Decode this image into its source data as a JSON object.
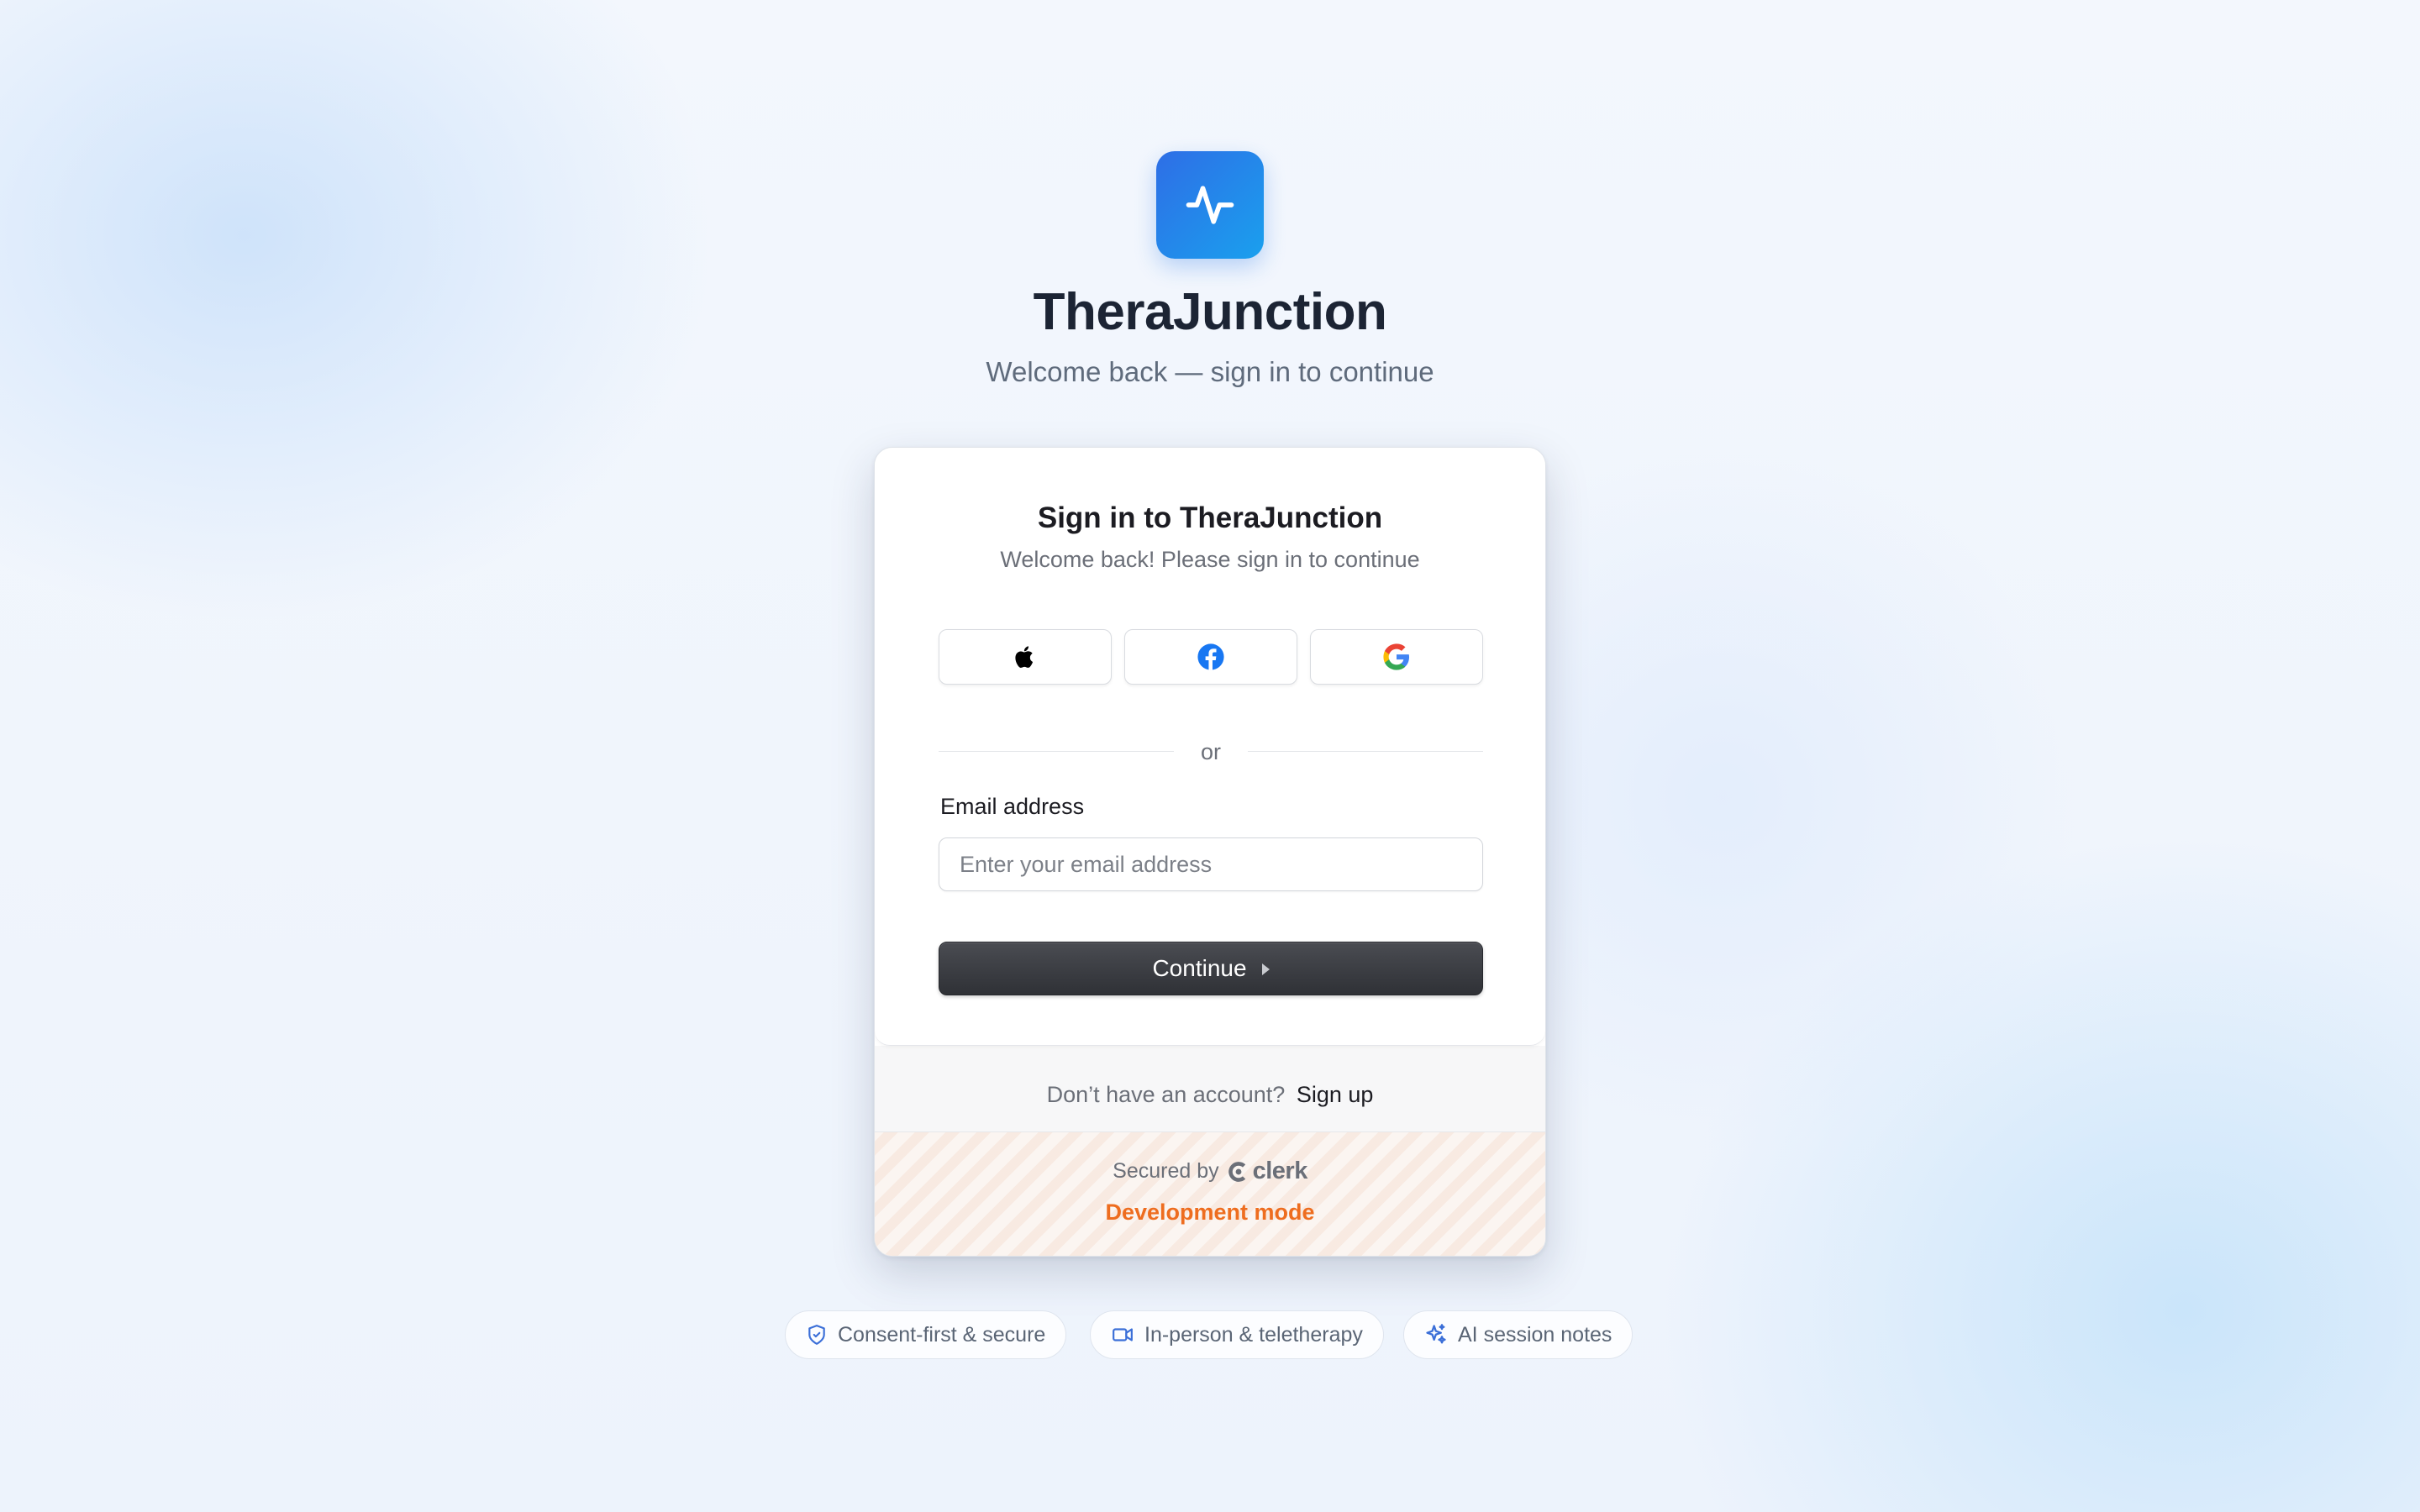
{
  "brand": {
    "name": "TheraJunction",
    "tagline": "Welcome back — sign in to continue",
    "logo_icon": "activity-pulse-icon",
    "accent_gradient": [
      "#2e6ee6",
      "#1aa0ee"
    ]
  },
  "signin_card": {
    "title": "Sign in to TheraJunction",
    "subtitle": "Welcome back! Please sign in to continue",
    "social_providers": [
      {
        "name": "Apple",
        "icon": "apple-icon"
      },
      {
        "name": "Facebook",
        "icon": "facebook-icon"
      },
      {
        "name": "Google",
        "icon": "google-icon"
      }
    ],
    "divider_text": "or",
    "email_label": "Email address",
    "email_placeholder": "Enter your email address",
    "email_value": "",
    "continue_label": "Continue",
    "signup_prompt": "Don’t have an account?",
    "signup_link": "Sign up",
    "secured_by": "Secured by",
    "secured_provider": "clerk",
    "dev_mode_label": "Development mode",
    "dev_mode_color": "#ee6d1f"
  },
  "feature_pills": [
    {
      "label": "Consent-first & secure",
      "icon": "shield-check-icon"
    },
    {
      "label": "In-person & teletherapy",
      "icon": "video-icon"
    },
    {
      "label": "AI session notes",
      "icon": "sparkles-icon"
    }
  ]
}
